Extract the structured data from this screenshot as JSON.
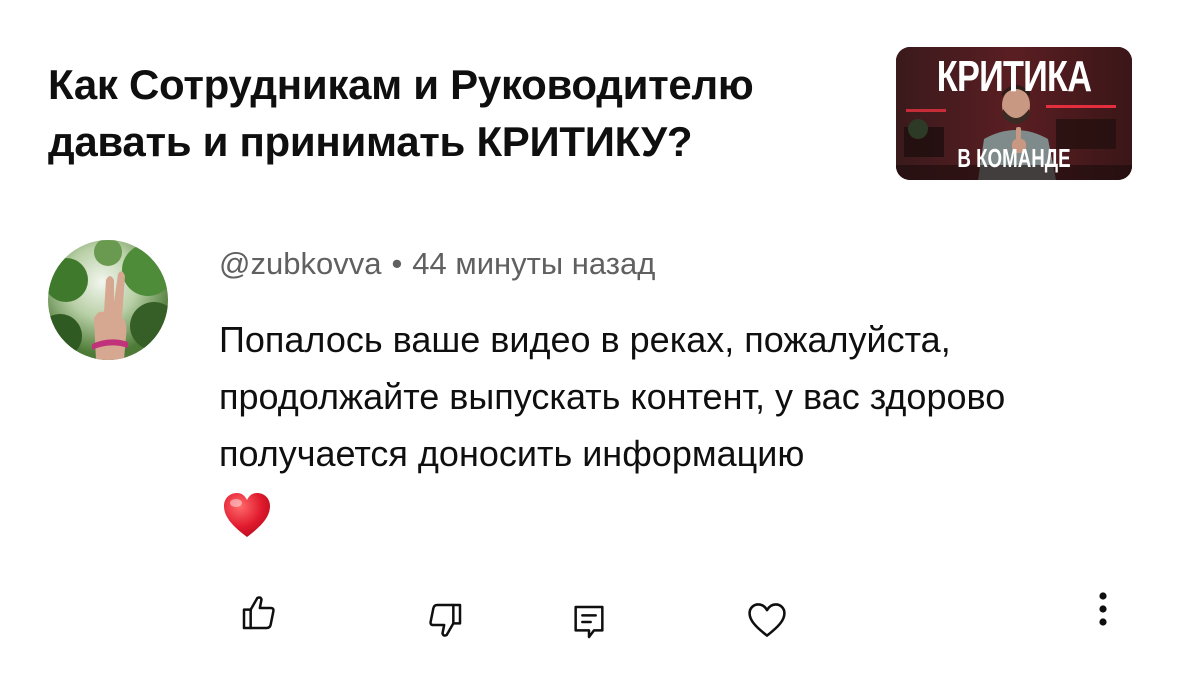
{
  "video": {
    "title": "Как Сотрудникам и Руководителю давать и принимать КРИТИКУ?",
    "thumbnail": {
      "top_text": "КРИТИКА",
      "bottom_text": "В КОМАНДЕ",
      "accent_color": "#c0202c"
    }
  },
  "comment": {
    "author": "@zubkovva",
    "separator": "•",
    "time_ago": "44 минуты назад",
    "text": "Попалось ваше видео в реках, пожалуйста, продолжайте выпускать контент, у вас здорово получается доносить информацию",
    "emoji": "red-heart"
  },
  "actions": {
    "icons": [
      "thumbs-up-icon",
      "thumbs-down-icon",
      "reply-icon",
      "heart-icon",
      "more-vertical-icon"
    ],
    "icon_color": "#0f0f0f"
  },
  "colors": {
    "meta_text": "#606060",
    "primary_text": "#0f0f0f",
    "heart_red": "#e0192d"
  }
}
